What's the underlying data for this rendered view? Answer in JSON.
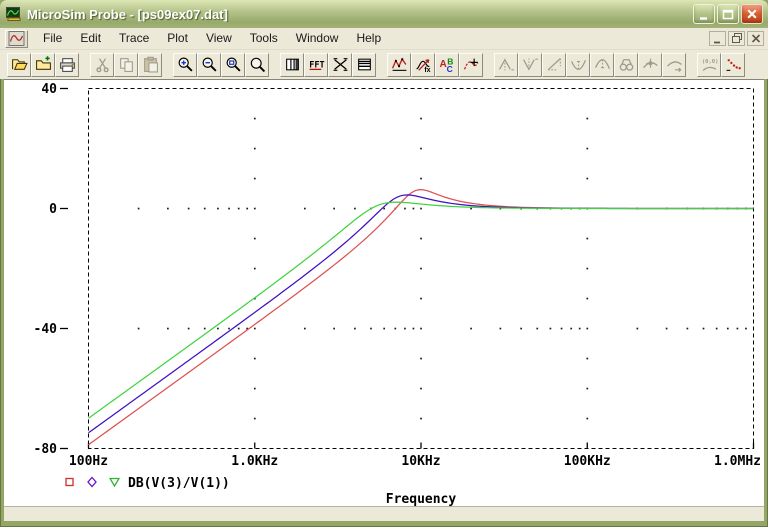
{
  "window": {
    "title": "MicroSim Probe - [ps09ex07.dat]",
    "theme_colors": {
      "titlebar_olive": "#9cad72",
      "chrome_bg": "#ece9d8",
      "frame": "#94a568",
      "close_red": "#c94a26",
      "plot_bg": "#ffffff"
    }
  },
  "menu_bar": {
    "items": [
      {
        "id": "file",
        "label": "File"
      },
      {
        "id": "edit",
        "label": "Edit"
      },
      {
        "id": "trace",
        "label": "Trace"
      },
      {
        "id": "plot",
        "label": "Plot"
      },
      {
        "id": "view",
        "label": "View"
      },
      {
        "id": "tools",
        "label": "Tools"
      },
      {
        "id": "window",
        "label": "Window"
      },
      {
        "id": "help",
        "label": "Help"
      }
    ]
  },
  "toolbar": {
    "groups": [
      [
        {
          "id": "open",
          "icon": "open-icon",
          "enabled": true
        },
        {
          "id": "append-file",
          "icon": "append-file-icon",
          "enabled": true
        },
        {
          "id": "print",
          "icon": "print-icon",
          "enabled": true
        }
      ],
      [
        {
          "id": "cut",
          "icon": "cut-icon",
          "enabled": false
        },
        {
          "id": "copy",
          "icon": "copy-icon",
          "enabled": false
        },
        {
          "id": "paste",
          "icon": "paste-icon",
          "enabled": false
        }
      ],
      [
        {
          "id": "zoom-in",
          "icon": "zoom-in-icon",
          "enabled": true
        },
        {
          "id": "zoom-out",
          "icon": "zoom-out-icon",
          "enabled": true
        },
        {
          "id": "zoom-area",
          "icon": "zoom-area-icon",
          "enabled": true
        },
        {
          "id": "zoom-fit",
          "icon": "zoom-fit-icon",
          "enabled": true
        }
      ],
      [
        {
          "id": "log-x-axis",
          "icon": "log-x-axis-icon",
          "enabled": true
        },
        {
          "id": "fft",
          "icon": "fft-icon",
          "enabled": true
        },
        {
          "id": "performance-analysis",
          "icon": "performance-analysis-icon",
          "enabled": true
        },
        {
          "id": "log-y-axis",
          "icon": "log-y-axis-icon",
          "enabled": true
        }
      ],
      [
        {
          "id": "add-trace",
          "icon": "add-trace-icon",
          "enabled": true
        },
        {
          "id": "eval-goal-function",
          "icon": "eval-goal-function-icon",
          "enabled": true
        },
        {
          "id": "insert-text-label",
          "icon": "insert-text-label-icon",
          "enabled": true
        },
        {
          "id": "toggle-cursor",
          "icon": "toggle-cursor-icon",
          "enabled": true
        }
      ],
      [
        {
          "id": "cursor-peak",
          "icon": "cursor-peak-icon",
          "enabled": false
        },
        {
          "id": "cursor-trough",
          "icon": "cursor-trough-icon",
          "enabled": false
        },
        {
          "id": "cursor-slope",
          "icon": "cursor-slope-icon",
          "enabled": false
        },
        {
          "id": "cursor-min",
          "icon": "cursor-min-icon",
          "enabled": false
        },
        {
          "id": "cursor-max",
          "icon": "cursor-max-icon",
          "enabled": false
        },
        {
          "id": "cursor-search",
          "icon": "cursor-search-icon",
          "enabled": false
        },
        {
          "id": "cursor-point",
          "icon": "cursor-point-icon",
          "enabled": false
        },
        {
          "id": "cursor-next",
          "icon": "cursor-next-icon",
          "enabled": false
        }
      ],
      [
        {
          "id": "label-point",
          "icon": "label-point-icon",
          "enabled": false
        },
        {
          "id": "mark-data-points",
          "icon": "mark-data-points-icon",
          "enabled": true
        }
      ]
    ]
  },
  "chart_data": {
    "type": "line",
    "title": "",
    "xlabel": "Frequency",
    "ylabel": "",
    "x_axis": {
      "scale": "log",
      "min": 100,
      "max": 1000000,
      "ticks": [
        {
          "value": 100,
          "label": "100Hz"
        },
        {
          "value": 1000,
          "label": "1.0KHz"
        },
        {
          "value": 10000,
          "label": "10KHz"
        },
        {
          "value": 100000,
          "label": "100KHz"
        },
        {
          "value": 1000000,
          "label": "1.0MHz"
        }
      ]
    },
    "y_axis": {
      "min": -80,
      "max": 40,
      "unit": "dB",
      "ticks": [
        {
          "value": 40,
          "label": "40"
        },
        {
          "value": 0,
          "label": "0"
        },
        {
          "value": -40,
          "label": "-40"
        },
        {
          "value": -80,
          "label": "-80"
        }
      ]
    },
    "grid": {
      "row_dot_rows_db": [
        0,
        -40
      ],
      "row_dot_minor_multipliers": [
        2,
        3,
        4,
        5,
        6,
        7,
        8,
        9
      ],
      "col_dot_freqs": [
        1000,
        10000,
        100000
      ],
      "col_dot_db_from": 30,
      "col_dot_db_to": -70,
      "col_dot_db_step": 10,
      "border_style": "dashed"
    },
    "legend": {
      "position": "bottom-left",
      "label": "DB(V(3)/V(1))",
      "entries": [
        {
          "marker": "square",
          "color": "#cc3030"
        },
        {
          "marker": "diamond",
          "color": "#6a11cc"
        },
        {
          "marker": "triangle-down",
          "color": "#2cb82c"
        }
      ]
    },
    "series": [
      {
        "name": "DB(V(3)/V(1))",
        "color": "#e05050",
        "model": {
          "type": "second-order-highpass",
          "f0_hz": 9300,
          "q": 2.0
        },
        "points": [
          [
            100,
            -78.7
          ],
          [
            300,
            -59.6
          ],
          [
            1000,
            -38.7
          ],
          [
            3000,
            -18.8
          ],
          [
            6000,
            -4.1
          ],
          [
            9300,
            6.0
          ],
          [
            9950,
            6.3
          ],
          [
            13000,
            4.4
          ],
          [
            21000,
            1.5
          ],
          [
            50000,
            0.3
          ],
          [
            100000,
            0.1
          ],
          [
            1000000,
            0.0
          ]
        ]
      },
      {
        "name": "DB(V(3)/V(1))",
        "color": "#3f10c5",
        "model": {
          "type": "second-order-highpass",
          "f0_hz": 7400,
          "q": 1.6
        },
        "points": [
          [
            100,
            -74.8
          ],
          [
            300,
            -55.7
          ],
          [
            1000,
            -34.6
          ],
          [
            3000,
            -14.5
          ],
          [
            5500,
            -1.4
          ],
          [
            7400,
            4.1
          ],
          [
            7900,
            4.4
          ],
          [
            11000,
            3.2
          ],
          [
            16000,
            1.5
          ],
          [
            33000,
            0.4
          ],
          [
            100000,
            0.0
          ],
          [
            1000000,
            0.0
          ]
        ]
      },
      {
        "name": "DB(V(3)/V(1))",
        "color": "#3fd43f",
        "model": {
          "type": "second-order-highpass",
          "f0_hz": 5600,
          "q": 1.15
        },
        "points": [
          [
            100,
            -69.9
          ],
          [
            300,
            -50.8
          ],
          [
            1000,
            -29.8
          ],
          [
            2000,
            -17.2
          ],
          [
            4000,
            -3.8
          ],
          [
            5600,
            1.2
          ],
          [
            7000,
            2.1
          ],
          [
            11000,
            1.2
          ],
          [
            22000,
            0.3
          ],
          [
            100000,
            0.0
          ],
          [
            1000000,
            0.0
          ]
        ]
      }
    ]
  },
  "status_bar": {
    "text": ""
  }
}
